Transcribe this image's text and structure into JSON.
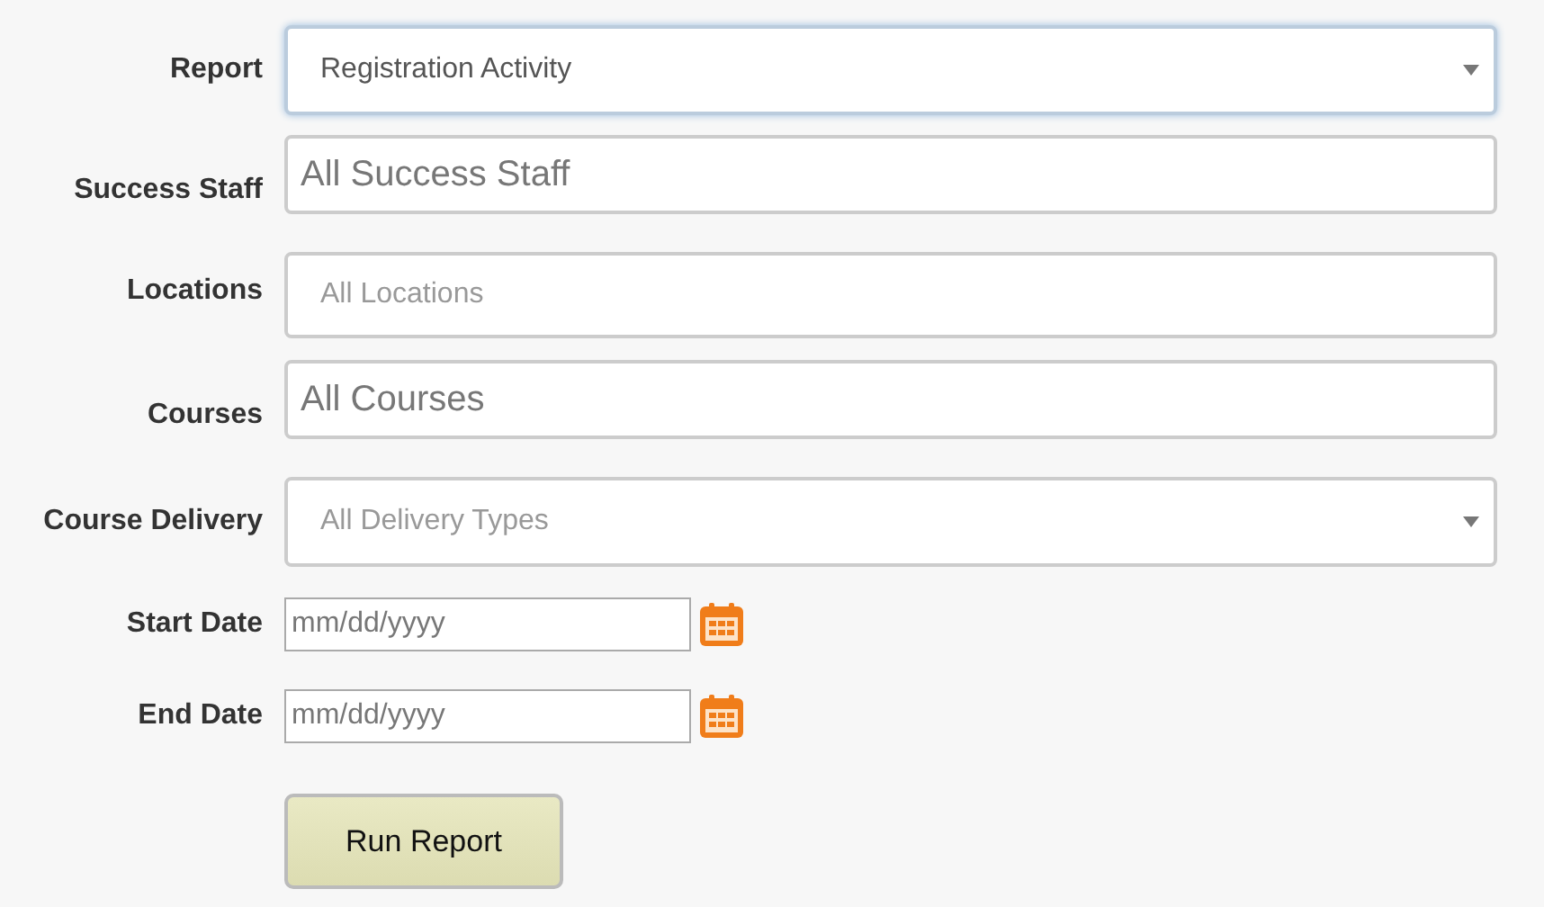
{
  "fields": [
    {
      "kind": "select",
      "label": "Report",
      "value": "Registration Activity",
      "focused": true
    },
    {
      "kind": "tags",
      "label": "Success Staff",
      "placeholder": "All Success Staff",
      "focused": false
    },
    {
      "kind": "search",
      "label": "Locations",
      "placeholder": "All Locations",
      "focused": false
    },
    {
      "kind": "tags",
      "label": "Courses",
      "placeholder": "All Courses",
      "focused": false
    },
    {
      "kind": "select",
      "label": "Course Delivery",
      "placeholder": "All Delivery Types",
      "focused": false
    },
    {
      "kind": "date",
      "label": "Start Date",
      "placeholder": "mm/dd/yyyy",
      "focused": false
    },
    {
      "kind": "date",
      "label": "End Date",
      "placeholder": "mm/dd/yyyy",
      "focused": false
    }
  ],
  "button": {
    "label": "Run Report"
  }
}
